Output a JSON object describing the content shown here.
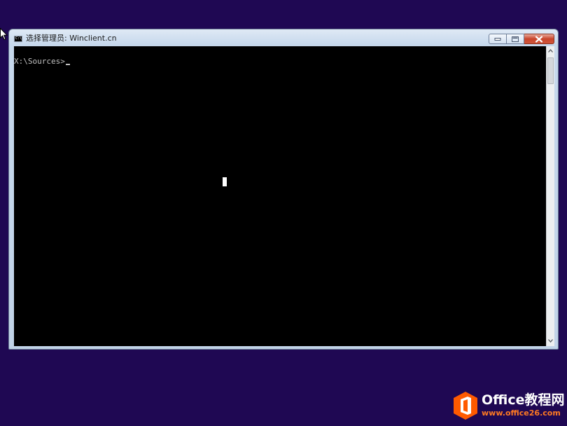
{
  "desktop": {
    "background_color": "#1f0853"
  },
  "window": {
    "title": "选择管理员: Winclient.cn",
    "icon": "cmd-icon",
    "icon_text": "C:\\",
    "buttons": {
      "minimize": "minimize-icon",
      "maximize": "maximize-icon",
      "close": "close-icon"
    },
    "close_color": "#c9462c"
  },
  "console": {
    "prompt": "X:\\Sources>",
    "text_color": "#c0c0c0",
    "background_color": "#000000"
  },
  "watermark": {
    "brand": "Office教程网",
    "url": "www.office26.com",
    "logo_color": "#ff5a00"
  }
}
